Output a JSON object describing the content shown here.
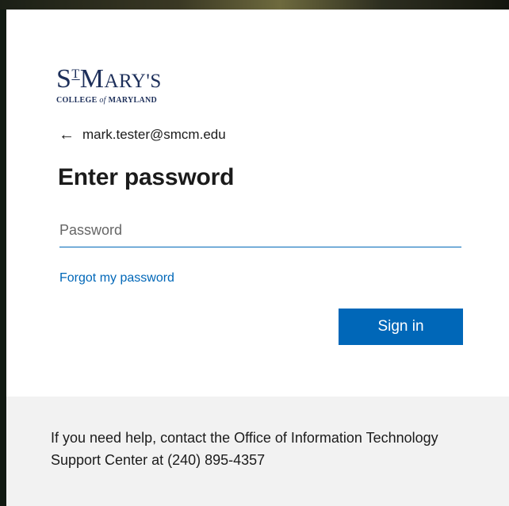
{
  "logo": {
    "name_s": "S",
    "name_t": "T",
    "name_m": "M",
    "name_rest": "ARY'S",
    "college_prefix": "COLLEGE",
    "college_of": "of",
    "college_suffix": "MARYLAND",
    "icon": "st-marys-college-logo"
  },
  "identity": {
    "back_icon": "←",
    "email": "mark.tester@smcm.edu"
  },
  "title": "Enter password",
  "password_field": {
    "placeholder": "Password",
    "value": ""
  },
  "forgot_link": "Forgot my password",
  "signin_button": "Sign in",
  "footer": {
    "help_text": "If you need help, contact the Office of Information Technology Support Center at (240) 895-4357"
  },
  "colors": {
    "accent": "#0067b8",
    "logo_navy": "#1d2f5a",
    "footer_bg": "#f2f2f2"
  }
}
